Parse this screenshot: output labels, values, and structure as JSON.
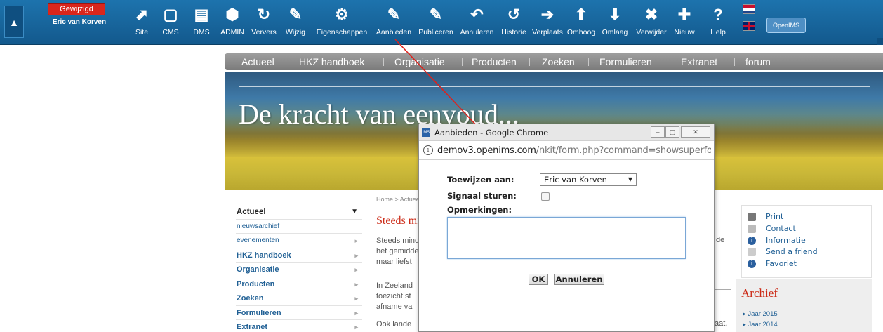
{
  "toolbar": {
    "status_badge": "Gewijzigd",
    "user_name": "Eric van Korven",
    "buttons": [
      {
        "label": "Site",
        "icon": "site-icon",
        "glyph": "⬈"
      },
      {
        "label": "CMS",
        "icon": "cms-icon",
        "glyph": "▢"
      },
      {
        "label": "DMS",
        "icon": "dms-icon",
        "glyph": "▤"
      },
      {
        "label": "ADMIN",
        "icon": "admin-icon",
        "glyph": "⬢"
      },
      {
        "label": "Ververs",
        "icon": "refresh-icon",
        "glyph": "↻"
      },
      {
        "label": "Wijzig",
        "icon": "edit-icon",
        "glyph": "✎"
      },
      {
        "label": "Eigenschappen",
        "icon": "gear-icon",
        "glyph": "⚙"
      },
      {
        "label": "Aanbieden",
        "icon": "offer-icon",
        "glyph": "✎"
      },
      {
        "label": "Publiceren",
        "icon": "publish-icon",
        "glyph": "✎"
      },
      {
        "label": "Annuleren",
        "icon": "undo-icon",
        "glyph": "↶"
      },
      {
        "label": "Historie",
        "icon": "history-icon",
        "glyph": "↺"
      },
      {
        "label": "Verplaats",
        "icon": "move-icon",
        "glyph": "➔"
      },
      {
        "label": "Omhoog",
        "icon": "up-icon",
        "glyph": "⬆"
      },
      {
        "label": "Omlaag",
        "icon": "down-icon",
        "glyph": "⬇"
      },
      {
        "label": "Verwijder",
        "icon": "delete-icon",
        "glyph": "✖"
      },
      {
        "label": "Nieuw",
        "icon": "new-icon",
        "glyph": "✚"
      },
      {
        "label": "Help",
        "icon": "help-icon",
        "glyph": "?"
      }
    ],
    "openims_label": "OpenIMS"
  },
  "nav": {
    "items": [
      "Actueel",
      "HKZ handboek",
      "Organisatie",
      "Producten",
      "Zoeken",
      "Formulieren",
      "Extranet",
      "forum"
    ]
  },
  "banner": {
    "title": "De kracht van eenvoud..."
  },
  "leftmenu": {
    "items": [
      {
        "label": "Actueel",
        "kind": "head"
      },
      {
        "label": "nieuwsarchief",
        "kind": "sub"
      },
      {
        "label": "evenementen",
        "kind": "sub"
      },
      {
        "label": "HKZ handboek",
        "kind": "main"
      },
      {
        "label": "Organisatie",
        "kind": "main"
      },
      {
        "label": "Producten",
        "kind": "main"
      },
      {
        "label": "Zoeken",
        "kind": "main"
      },
      {
        "label": "Formulieren",
        "kind": "main"
      },
      {
        "label": "Extranet",
        "kind": "main"
      }
    ]
  },
  "content": {
    "breadcrumb": "Home > Actueel",
    "title": "Steeds minder",
    "lines": [
      "Steeds minder",
      "het gemiddeld",
      "maar liefst",
      "",
      "In Zeeland",
      "toezicht st",
      "afname va",
      "",
      "Ook lande"
    ],
    "right_fragments": [
      "de",
      "aat,"
    ]
  },
  "tools": {
    "items": [
      {
        "label": "Print",
        "icon": "printer-icon",
        "color": "#777777",
        "glyph": "▭"
      },
      {
        "label": "Contact",
        "icon": "contact-icon",
        "color": "#bbbbbb",
        "glyph": "▭"
      },
      {
        "label": "Informatie",
        "icon": "info-icon",
        "color": "#2a5f9e",
        "glyph": "i"
      },
      {
        "label": "Send a friend",
        "icon": "send-icon",
        "color": "#cccccc",
        "glyph": "◁"
      },
      {
        "label": "Favoriet",
        "icon": "favorite-icon",
        "color": "#2a5f9e",
        "glyph": "i"
      }
    ]
  },
  "archive": {
    "title": "Archief",
    "items": [
      "▸ Jaar 2015",
      "▸ Jaar 2014"
    ]
  },
  "popup": {
    "window_title": "Aanbieden - Google Chrome",
    "favicon_text": "IMS",
    "url_host": "demov3.openims.com",
    "url_path": "/nkit/form.php?command=showsuperfo",
    "assign_label": "Toewijzen aan:",
    "assign_value": "Eric van Korven",
    "signal_label": "Signaal sturen:",
    "signal_checked": false,
    "remarks_label": "Opmerkingen:",
    "remarks_value": "",
    "ok_label": "OK",
    "cancel_label": "Annuleren"
  },
  "colors": {
    "toolbar_blue": "#1a6aa3",
    "status_red": "#d9261c",
    "accent_red": "#cc2a16",
    "link_blue": "#1f5f94",
    "nav_gray": "#8a8a8a"
  }
}
